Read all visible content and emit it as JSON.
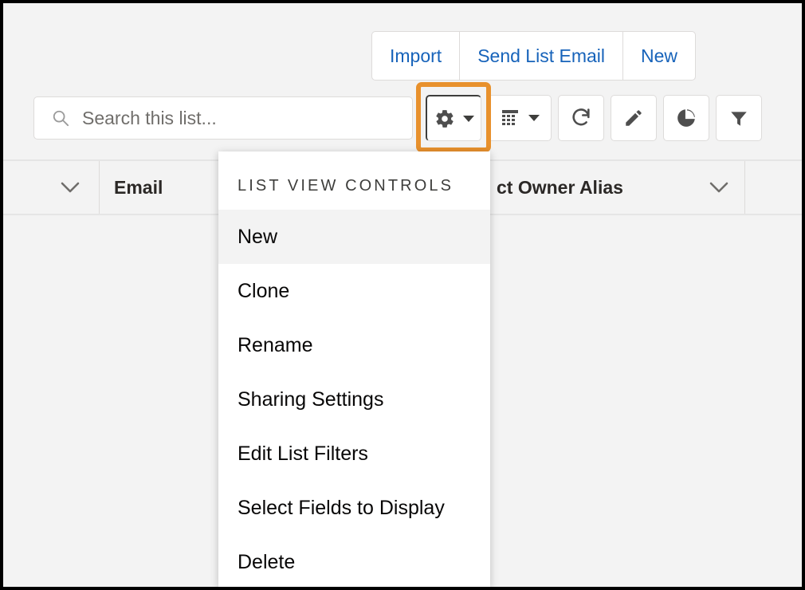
{
  "window": {
    "background_color": "#f3f3f3",
    "border_color": "#000000"
  },
  "action_bar": {
    "buttons": [
      {
        "label": "Import",
        "name": "import-button"
      },
      {
        "label": "Send List Email",
        "name": "send-list-email-button"
      },
      {
        "label": "New",
        "name": "new-button"
      }
    ],
    "link_color": "#1763ba"
  },
  "search": {
    "placeholder": "Search this list...",
    "value": "",
    "icon": "search-icon"
  },
  "toolbar": {
    "highlight_color": "#e8912d",
    "buttons": [
      {
        "name": "list-view-controls-button",
        "icon": "gear-icon",
        "has_caret": true,
        "highlighted": true
      },
      {
        "name": "display-as-button",
        "icon": "table-grid-icon",
        "has_caret": true,
        "highlighted": false
      },
      {
        "name": "refresh-button",
        "icon": "refresh-icon",
        "has_caret": false,
        "highlighted": false
      },
      {
        "name": "edit-button",
        "icon": "pencil-icon",
        "has_caret": false,
        "highlighted": false
      },
      {
        "name": "charts-button",
        "icon": "pie-chart-icon",
        "has_caret": false,
        "highlighted": false
      },
      {
        "name": "filters-button",
        "icon": "funnel-icon",
        "has_caret": false,
        "highlighted": false
      }
    ]
  },
  "table": {
    "columns": [
      {
        "label": "",
        "name": "table-header-checkbox-column",
        "has_chevron": true
      },
      {
        "label": "Email",
        "name": "table-header-email",
        "has_chevron": false
      },
      {
        "label": "ct Owner Alias",
        "name": "table-header-owner-alias",
        "has_chevron": true
      },
      {
        "label": "",
        "name": "table-header-last-column",
        "has_chevron": false
      }
    ]
  },
  "menu": {
    "header": "LIST VIEW CONTROLS",
    "items": [
      {
        "label": "New",
        "name": "menu-item-new",
        "selected": true
      },
      {
        "label": "Clone",
        "name": "menu-item-clone",
        "selected": false
      },
      {
        "label": "Rename",
        "name": "menu-item-rename",
        "selected": false
      },
      {
        "label": "Sharing Settings",
        "name": "menu-item-sharing-settings",
        "selected": false
      },
      {
        "label": "Edit List Filters",
        "name": "menu-item-edit-list-filters",
        "selected": false
      },
      {
        "label": "Select Fields to Display",
        "name": "menu-item-select-fields-to-display",
        "selected": false
      },
      {
        "label": "Delete",
        "name": "menu-item-delete",
        "selected": false
      }
    ]
  }
}
